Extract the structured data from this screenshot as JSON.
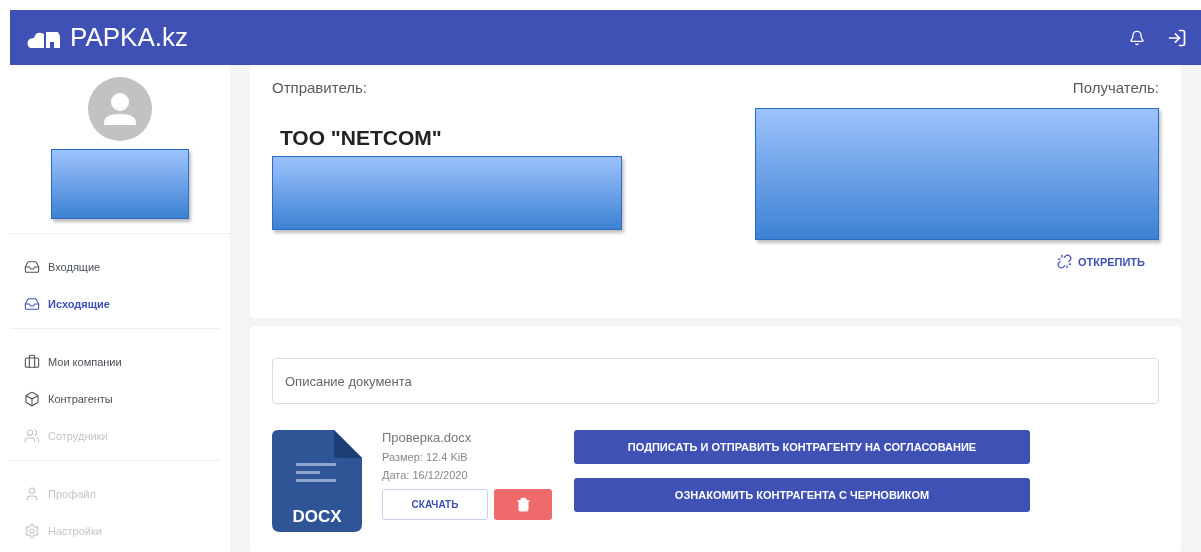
{
  "header": {
    "logo": "PAPKA.kz"
  },
  "sidebar": {
    "groups": [
      {
        "items": [
          {
            "label": "Входящие",
            "selected": false,
            "disabled": false
          },
          {
            "label": "Исходящие",
            "selected": true,
            "disabled": false
          }
        ]
      },
      {
        "items": [
          {
            "label": "Мои компании",
            "selected": false,
            "disabled": false
          },
          {
            "label": "Контрагенты",
            "selected": false,
            "disabled": false
          },
          {
            "label": "Сотрудники",
            "selected": false,
            "disabled": true
          }
        ]
      },
      {
        "items": [
          {
            "label": "Профайл",
            "selected": false,
            "disabled": true
          },
          {
            "label": "Настройки",
            "selected": false,
            "disabled": true
          }
        ]
      }
    ]
  },
  "parties": {
    "sender_label": "Отправитель:",
    "recipient_label": "Получатель:",
    "sender_name": "ТОО \"NETCOM\"",
    "unpin": "ОТКРЕПИТЬ"
  },
  "document": {
    "description_placeholder": "Описание документа",
    "file_name": "Проверка.docx",
    "size": "Размер: 12.4 KiB",
    "date": "Дата: 16/12/2020",
    "file_type": "DOCX",
    "download": "СКАЧАТЬ",
    "actions": [
      "ПОДПИСАТЬ И ОТПРАВИТЬ КОНТРАГЕНТУ НА СОГЛАСОВАНИЕ",
      "ОЗНАКОМИТЬ КОНТРАГЕНТА С ЧЕРНОВИКОМ"
    ]
  }
}
